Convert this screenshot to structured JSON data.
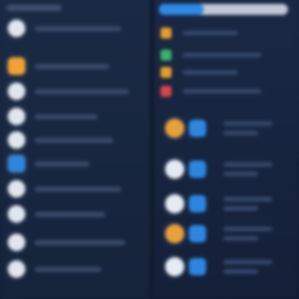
{
  "left_panel": {
    "rows": [
      {
        "icon": "circle-icon",
        "color": "#dfe6ef",
        "line_width": 110
      },
      {
        "icon": "app-icon-orange",
        "color": "#f2a233",
        "line_width": 95,
        "selected": true
      },
      {
        "icon": "circle-icon",
        "color": "#dfe6ef",
        "line_width": 120
      },
      {
        "icon": "circle-icon",
        "color": "#dfe6ef",
        "line_width": 80
      },
      {
        "icon": "circle-icon",
        "color": "#dfe6ef",
        "line_width": 100
      },
      {
        "icon": "app-icon-blue",
        "color": "#2f86df",
        "line_width": 70
      },
      {
        "icon": "circle-icon",
        "color": "#dfe6ef",
        "line_width": 110
      },
      {
        "icon": "circle-icon",
        "color": "#dfe6ef",
        "line_width": 90
      },
      {
        "icon": "circle-icon",
        "color": "#dfe6ef",
        "line_width": 115
      },
      {
        "icon": "circle-icon",
        "color": "#dfe6ef",
        "line_width": 85
      }
    ]
  },
  "right_panel": {
    "progress": 0.35,
    "colors": {
      "accent": "#2d8ae6",
      "track": "#bfc8d4"
    },
    "status_rows": [
      {
        "color": "#e59d2c"
      },
      {
        "color": "#3bb36a"
      },
      {
        "color": "#e59d2c"
      },
      {
        "color": "#d8454a"
      }
    ],
    "pairs": [
      {
        "icon": "app-icon-orange",
        "left_color": "#e8a039",
        "toggle": true
      },
      {
        "icon": "circle-icon",
        "left_color": "#e5ebf3",
        "toggle": true
      },
      {
        "icon": "circle-icon",
        "left_color": "#e5ebf3",
        "toggle": true
      },
      {
        "icon": "app-icon-orange",
        "left_color": "#e8a039",
        "toggle": true
      },
      {
        "icon": "circle-icon",
        "left_color": "#e5ebf3",
        "toggle": true
      }
    ]
  }
}
